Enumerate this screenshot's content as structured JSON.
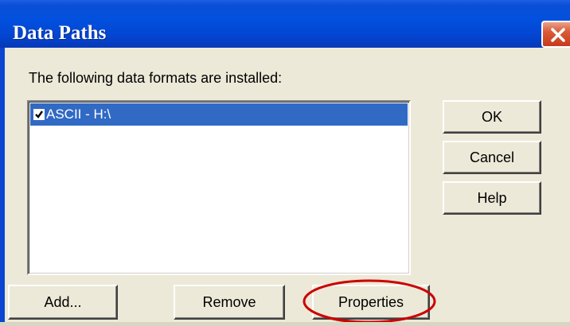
{
  "window": {
    "title": "Data Paths",
    "close_icon": "close-icon"
  },
  "list": {
    "label": "The following data formats are installed:",
    "items": [
      {
        "label": "ASCII - H:\\",
        "checked": true,
        "selected": true
      }
    ]
  },
  "side_buttons": {
    "ok": "OK",
    "cancel": "Cancel",
    "help": "Help"
  },
  "bottom_buttons": {
    "add": "Add...",
    "remove": "Remove",
    "properties": "Properties"
  },
  "colors": {
    "titlebar": "#0250de",
    "selection": "#316ac5",
    "dialog_bg": "#ece9d8",
    "annotation": "#cc0000"
  }
}
